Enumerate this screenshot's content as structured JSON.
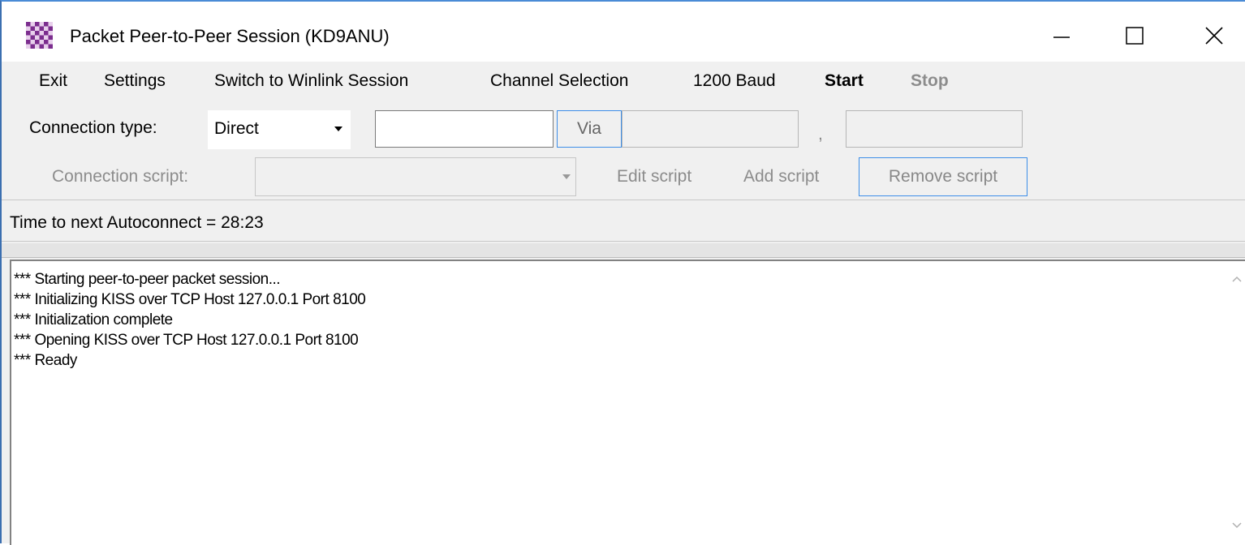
{
  "window": {
    "title": "Packet Peer-to-Peer Session  (KD9ANU)"
  },
  "menu": {
    "exit": "Exit",
    "settings": "Settings",
    "switch_session": "Switch to Winlink Session",
    "channel_selection": "Channel Selection",
    "baud": "1200 Baud",
    "start": "Start",
    "stop": "Stop"
  },
  "connection": {
    "type_label": "Connection type:",
    "type_value": "Direct",
    "target_value": "",
    "via_label": "Via",
    "via1_value": "",
    "separator": ",",
    "via2_value": ""
  },
  "script": {
    "label": "Connection script:",
    "value": "",
    "edit_label": "Edit script",
    "add_label": "Add script",
    "remove_label": "Remove script"
  },
  "status": {
    "text": "Time to next Autoconnect = 28:23"
  },
  "log": {
    "lines": [
      "*** Starting peer-to-peer packet session...",
      "*** Initializing KISS over TCP Host 127.0.0.1 Port 8100",
      "*** Initialization complete",
      "*** Opening KISS over TCP Host 127.0.0.1 Port 8100",
      "*** Ready"
    ]
  },
  "icons": {
    "app": "checkered-app-icon",
    "minimize": "minimize-icon",
    "maximize": "maximize-icon",
    "close": "close-icon",
    "dropdown": "chevron-down-icon"
  },
  "colors": {
    "accent_border": "#3d8ee8",
    "app_icon_purple": "#7b2d8e",
    "disabled_text": "#8c8c8c"
  }
}
